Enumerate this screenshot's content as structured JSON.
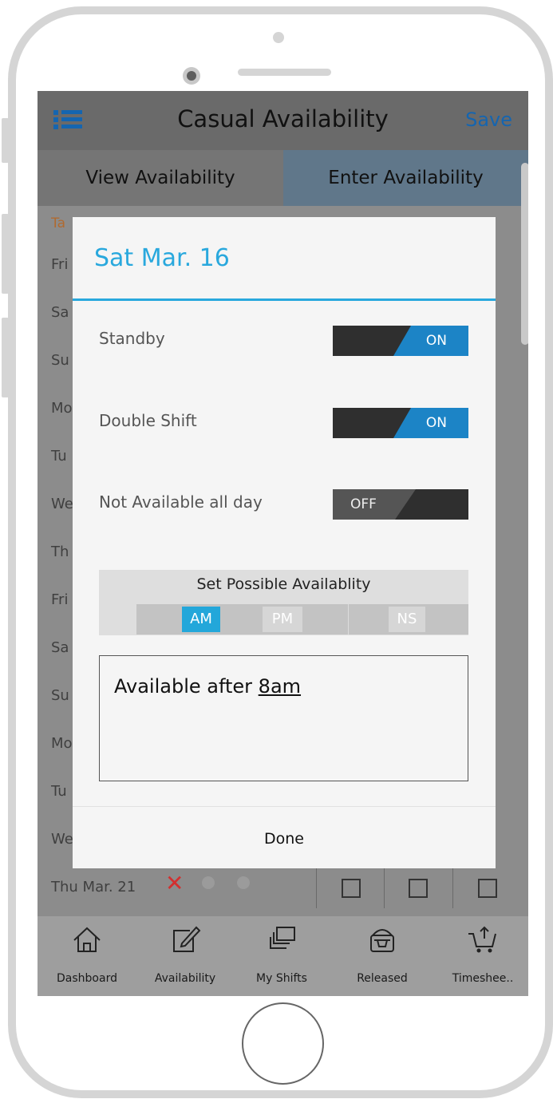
{
  "header": {
    "title": "Casual Availability",
    "save_label": "Save"
  },
  "tabs": [
    {
      "label": "View Availability"
    },
    {
      "label": "Enter Availability"
    }
  ],
  "background_list": {
    "header_label": "Ta",
    "rows": [
      "Fri",
      "Sa",
      "Su",
      "Mo",
      "Tu",
      "We",
      "Th",
      "Fri",
      "Sa",
      "Su",
      "Mo",
      "Tu",
      "We"
    ],
    "last_row_label": "Thu Mar. 21"
  },
  "modal": {
    "title": "Sat Mar. 16",
    "options": [
      {
        "label": "Standby",
        "state": "ON"
      },
      {
        "label": "Double Shift",
        "state": "ON"
      },
      {
        "label": "Not Available all day",
        "state": "OFF"
      }
    ],
    "availability": {
      "title": "Set Possible Availablity",
      "buttons": [
        {
          "label": "AM",
          "selected": true
        },
        {
          "label": "PM",
          "selected": false
        },
        {
          "label": "NS",
          "selected": false
        }
      ]
    },
    "notes": {
      "prefix": "Available after ",
      "underlined": "8am"
    },
    "done_label": "Done"
  },
  "bottom_nav": [
    {
      "label": "Dashboard",
      "icon": "home-icon"
    },
    {
      "label": "Availability",
      "icon": "edit-icon"
    },
    {
      "label": "My Shifts",
      "icon": "stack-icon"
    },
    {
      "label": "Released",
      "icon": "basket-icon"
    },
    {
      "label": "Timeshee..",
      "icon": "cart-icon"
    }
  ],
  "colors": {
    "accent_blue": "#29a8dd",
    "toggle_on": "#1c84c6",
    "menu_blue": "#1565b0",
    "cancel_red": "#d32f2f"
  }
}
